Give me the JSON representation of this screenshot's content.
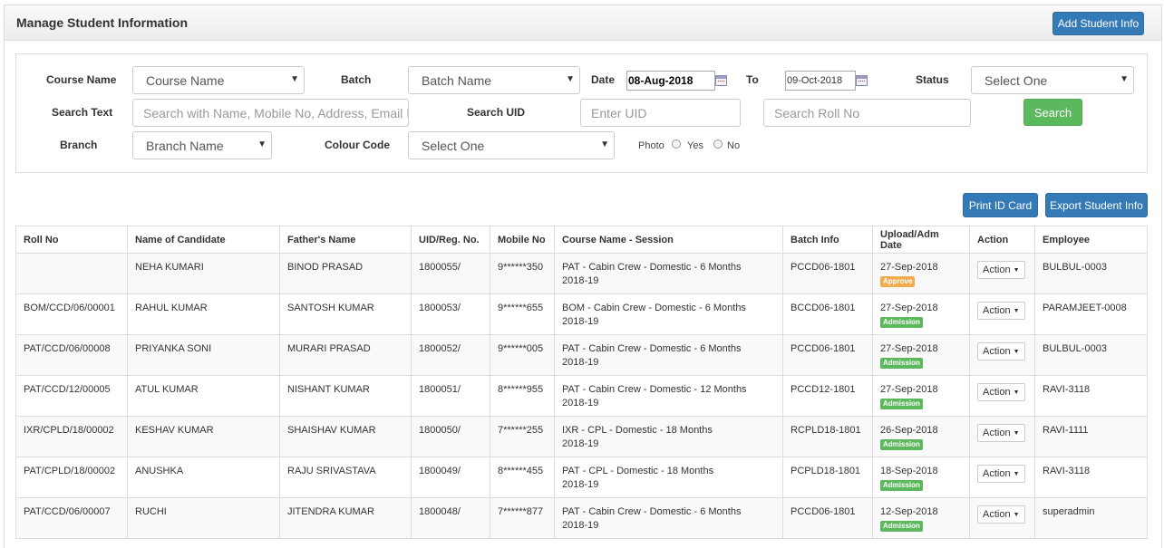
{
  "header": {
    "title": "Manage Student Information",
    "add_button": "Add Student Info"
  },
  "filters": {
    "course_label": "Course Name",
    "course_value": "Course Name",
    "batch_label": "Batch",
    "batch_value": "Batch Name",
    "date_label": "Date",
    "date_from": "08-Aug-2018",
    "to_label": "To",
    "date_to": "09-Oct-2018",
    "status_label": "Status",
    "status_value": "Select One",
    "search_text_label": "Search Text",
    "search_text_placeholder": "Search with Name,  Mobile No, Address, Email ID",
    "search_uid_label": "Search UID",
    "uid_placeholder": "Enter UID",
    "roll_placeholder": "Search Roll No",
    "search_button": "Search",
    "branch_label": "Branch",
    "branch_value": "Branch Name",
    "colour_label": "Colour Code",
    "colour_value": "Select One",
    "photo_label": "Photo",
    "photo_yes": "Yes",
    "photo_no": "No"
  },
  "toolbar": {
    "print_button": "Print ID Card",
    "export_button": "Export Student Info"
  },
  "table": {
    "columns": [
      "Roll No",
      "Name of Candidate",
      "Father's Name",
      "UID/Reg. No.",
      "Mobile No",
      "Course Name - Session",
      "Batch Info",
      "Upload/Adm Date",
      "Action",
      "Employee"
    ],
    "action_label": "Action",
    "rows": [
      {
        "roll": "",
        "name": "NEHA KUMARI",
        "father": "BINOD PRASAD",
        "uid": "1800055/",
        "mobile": "9******350",
        "course": "PAT - Cabin Crew - Domestic - 6 Months",
        "session": "2018-19",
        "batch": "PCCD06-1801",
        "date": "27-Sep-2018",
        "status": "Approve",
        "employee": "BULBUL-0003"
      },
      {
        "roll": "BOM/CCD/06/00001",
        "name": "RAHUL KUMAR",
        "father": "SANTOSH KUMAR",
        "uid": "1800053/",
        "mobile": "9******655",
        "course": "BOM - Cabin Crew - Domestic - 6 Months",
        "session": "2018-19",
        "batch": "BCCD06-1801",
        "date": "27-Sep-2018",
        "status": "Admission",
        "employee": "PARAMJEET-0008"
      },
      {
        "roll": "PAT/CCD/06/00008",
        "name": "PRIYANKA SONI",
        "father": "MURARI PRASAD",
        "uid": "1800052/",
        "mobile": "9******005",
        "course": "PAT - Cabin Crew - Domestic - 6 Months",
        "session": "2018-19",
        "batch": "PCCD06-1801",
        "date": "27-Sep-2018",
        "status": "Admission",
        "employee": "BULBUL-0003"
      },
      {
        "roll": "PAT/CCD/12/00005",
        "name": "ATUL KUMAR",
        "father": "NISHANT KUMAR",
        "uid": "1800051/",
        "mobile": "8******955",
        "course": "PAT - Cabin Crew - Domestic - 12 Months",
        "session": "2018-19",
        "batch": "PCCD12-1801",
        "date": "27-Sep-2018",
        "status": "Admission",
        "employee": "RAVI-3118"
      },
      {
        "roll": "IXR/CPLD/18/00002",
        "name": "KESHAV KUMAR",
        "father": "SHAISHAV KUMAR",
        "uid": "1800050/",
        "mobile": "7******255",
        "course": "IXR - CPL - Domestic - 18 Months",
        "session": "2018-19",
        "batch": "RCPLD18-1801",
        "date": "26-Sep-2018",
        "status": "Admission",
        "employee": "RAVI-1111"
      },
      {
        "roll": "PAT/CPLD/18/00002",
        "name": "ANUSHKA",
        "father": "RAJU SRIVASTAVA",
        "uid": "1800049/",
        "mobile": "8******455",
        "course": "PAT - CPL - Domestic - 18 Months",
        "session": "2018-19",
        "batch": "PCPLD18-1801",
        "date": "18-Sep-2018",
        "status": "Admission",
        "employee": "RAVI-3118"
      },
      {
        "roll": "PAT/CCD/06/00007",
        "name": "RUCHI",
        "father": "JITENDRA KUMAR",
        "uid": "1800048/",
        "mobile": "7******877",
        "course": "PAT - Cabin Crew - Domestic - 6 Months",
        "session": "2018-19",
        "batch": "PCCD06-1801",
        "date": "12-Sep-2018",
        "status": "Admission",
        "employee": "superadmin"
      }
    ]
  },
  "colors": {
    "primary": "#337ab7",
    "success": "#5cb85c",
    "approve": "#f0ad4e",
    "admission": "#5cb85c"
  }
}
